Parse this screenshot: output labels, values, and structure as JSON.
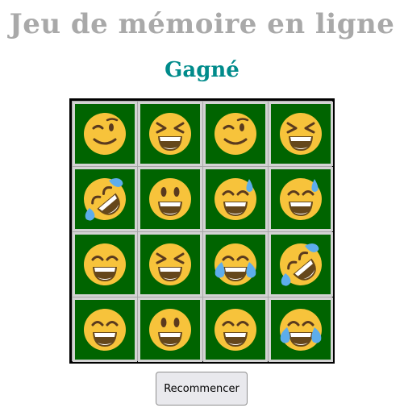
{
  "title": "Jeu de mémoire en ligne",
  "status": "Gagné",
  "board": {
    "rows": 4,
    "cols": 4,
    "cards": [
      "winking-face",
      "grinning-squinting-face",
      "winking-face",
      "grinning-squinting-face",
      "rolling-on-floor-laughing",
      "grinning-face-big-eyes",
      "grinning-face-sweat",
      "grinning-face-sweat",
      "beaming-face",
      "grinning-squinting-face",
      "face-tears-of-joy",
      "rolling-on-floor-laughing",
      "beaming-face",
      "grinning-face-big-eyes",
      "beaming-face",
      "face-tears-of-joy"
    ]
  },
  "colors": {
    "title": "#a9a9a9",
    "status": "#008b8b",
    "card_bg": "#006400",
    "card_border": "#d3d3d3",
    "emoji_face": "#f7c33b"
  },
  "button": {
    "label": "Recommencer"
  }
}
